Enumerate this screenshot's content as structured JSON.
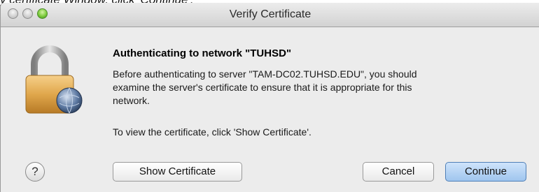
{
  "top_strip_text": "y certificate Window, click 'Continue'.",
  "window": {
    "title": "Verify Certificate",
    "controls": [
      "close",
      "minimize",
      "zoom"
    ]
  },
  "dialog": {
    "icon": "lock-icon",
    "headline": "Authenticating to network \"TUHSD\"",
    "body_lines": [
      "Before authenticating to server \"TAM-DC02.TUHSD.EDU\", you should",
      "examine the server's certificate to ensure that it is appropriate for this",
      "network."
    ],
    "instruction": "To view the certificate, click 'Show Certificate'."
  },
  "buttons": {
    "help": "?",
    "show_certificate": "Show Certificate",
    "cancel": "Cancel",
    "continue": "Continue"
  },
  "colors": {
    "default_button": "#9fc5ee",
    "lock_body": "#e0a74c"
  }
}
